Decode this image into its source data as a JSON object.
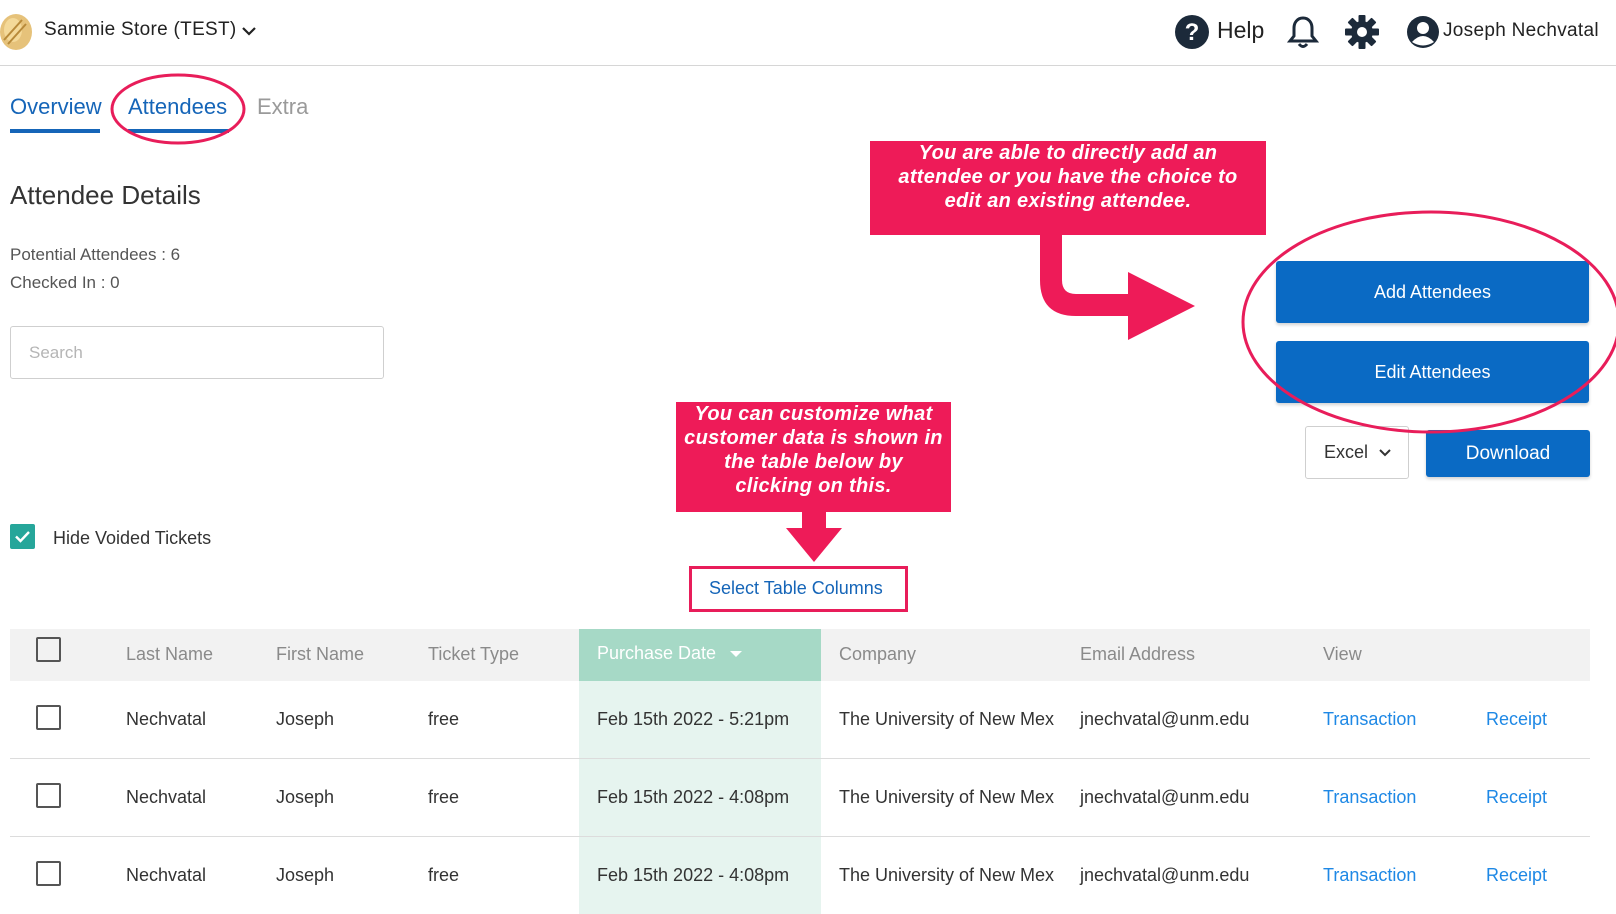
{
  "header": {
    "store_name": "Sammie Store (TEST)",
    "help_label": "Help",
    "user_name": "Joseph Nechvatal"
  },
  "tabs": [
    {
      "label": "Overview",
      "active": true
    },
    {
      "label": "Attendees",
      "active": true
    },
    {
      "label": "Extra",
      "active": false
    }
  ],
  "main": {
    "title": "Attendee Details",
    "potential_attendees": "Potential Attendees : 6",
    "checked_in": "Checked In : 0",
    "search_placeholder": "Search",
    "add_button": "Add Attendees",
    "edit_button": "Edit Attendees",
    "export_format": "Excel",
    "download_button": "Download",
    "hide_voided_label": "Hide Voided Tickets",
    "hide_voided_checked": true,
    "select_columns_link": "Select Table Columns"
  },
  "table": {
    "columns": [
      "Last Name",
      "First Name",
      "Ticket Type",
      "Purchase Date",
      "Company",
      "Email Address",
      "View"
    ],
    "sorted_column": "Purchase Date",
    "rows": [
      {
        "last": "Nechvatal",
        "first": "Joseph",
        "ticket": "free",
        "date": "Feb 15th 2022 - 5:21pm",
        "company": "The University of New Mex",
        "email": "jnechvatal@unm.edu",
        "transaction": "Transaction",
        "receipt": "Receipt"
      },
      {
        "last": "Nechvatal",
        "first": "Joseph",
        "ticket": "free",
        "date": "Feb 15th 2022 - 4:08pm",
        "company": "The University of New Mex",
        "email": "jnechvatal@unm.edu",
        "transaction": "Transaction",
        "receipt": "Receipt"
      },
      {
        "last": "Nechvatal",
        "first": "Joseph",
        "ticket": "free",
        "date": "Feb 15th 2022 - 4:08pm",
        "company": "The University of New Mex",
        "email": "jnechvatal@unm.edu",
        "transaction": "Transaction",
        "receipt": "Receipt"
      }
    ]
  },
  "annotations": {
    "callout_add_edit": "You are able to directly add an attendee or you have the choice to edit an existing attendee.",
    "callout_columns": "You can customize what customer data is shown in the table below by clicking on this."
  },
  "colors": {
    "primary": "#0a6ac4",
    "link": "#1e88e5",
    "annotation": "#ee1b58",
    "checkbox": "#26a69a",
    "sorted_header": "#a6d9c6"
  }
}
